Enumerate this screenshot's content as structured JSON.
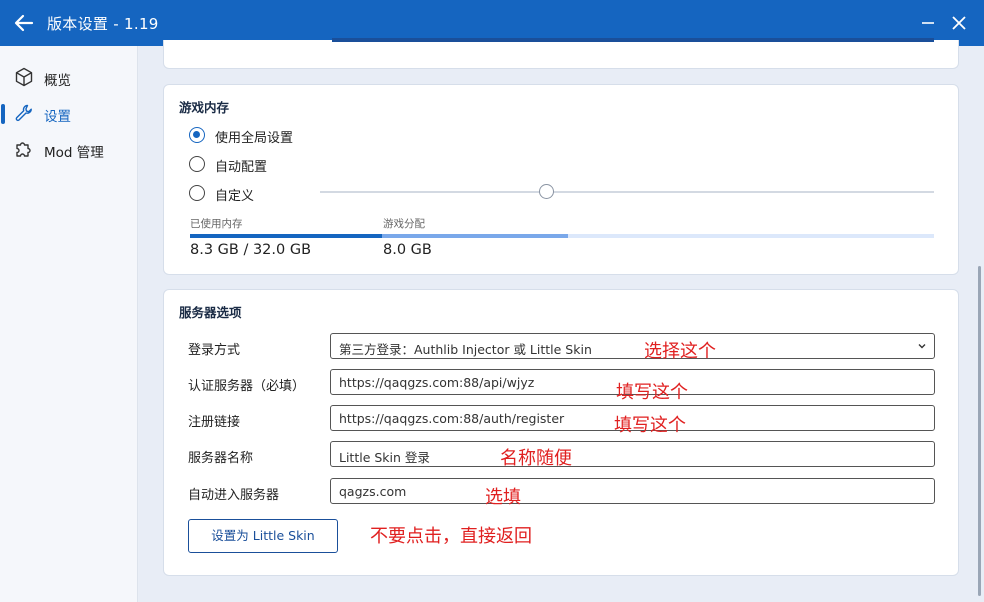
{
  "window": {
    "title": "版本设置 - 1.19",
    "back_icon": "arrow-left-icon",
    "minimize_icon": "minimize-icon",
    "close_icon": "close-icon"
  },
  "sidebar": {
    "items": [
      {
        "label": "概览",
        "icon": "cube-icon"
      },
      {
        "label": "设置",
        "icon": "wrench-icon",
        "active": true
      },
      {
        "label": "Mod 管理",
        "icon": "puzzle-icon"
      }
    ]
  },
  "memory": {
    "title": "游戏内存",
    "options": [
      {
        "label": "使用全局设置",
        "checked": true
      },
      {
        "label": "自动配置",
        "checked": false
      },
      {
        "label": "自定义",
        "checked": false
      }
    ],
    "used_caption": "已使用内存",
    "alloc_caption": "游戏分配",
    "used_value": "8.3 GB / 32.0 GB",
    "alloc_value": "8.0 GB",
    "used_fraction": 0.26,
    "alloc_fraction": 0.25
  },
  "server": {
    "title": "服务器选项",
    "fields": [
      {
        "label": "登录方式",
        "value": "第三方登录：Authlib Injector 或 Little Skin",
        "type": "select"
      },
      {
        "label": "认证服务器（必填）",
        "value": "https://qaqgzs.com:88/api/wjyz"
      },
      {
        "label": "注册链接",
        "value": "https://qaqgzs.com:88/auth/register"
      },
      {
        "label": "服务器名称",
        "value": "Little Skin 登录"
      },
      {
        "label": "自动进入服务器",
        "value": "qagzs.com"
      }
    ],
    "button_label": "设置为 Little Skin"
  },
  "annotations": [
    "选择这个",
    "填写这个",
    "填写这个",
    "名称随便",
    "选填",
    "不要点击，直接返回"
  ],
  "colors": {
    "accent": "#1565c0",
    "annotation": "#e02020"
  }
}
